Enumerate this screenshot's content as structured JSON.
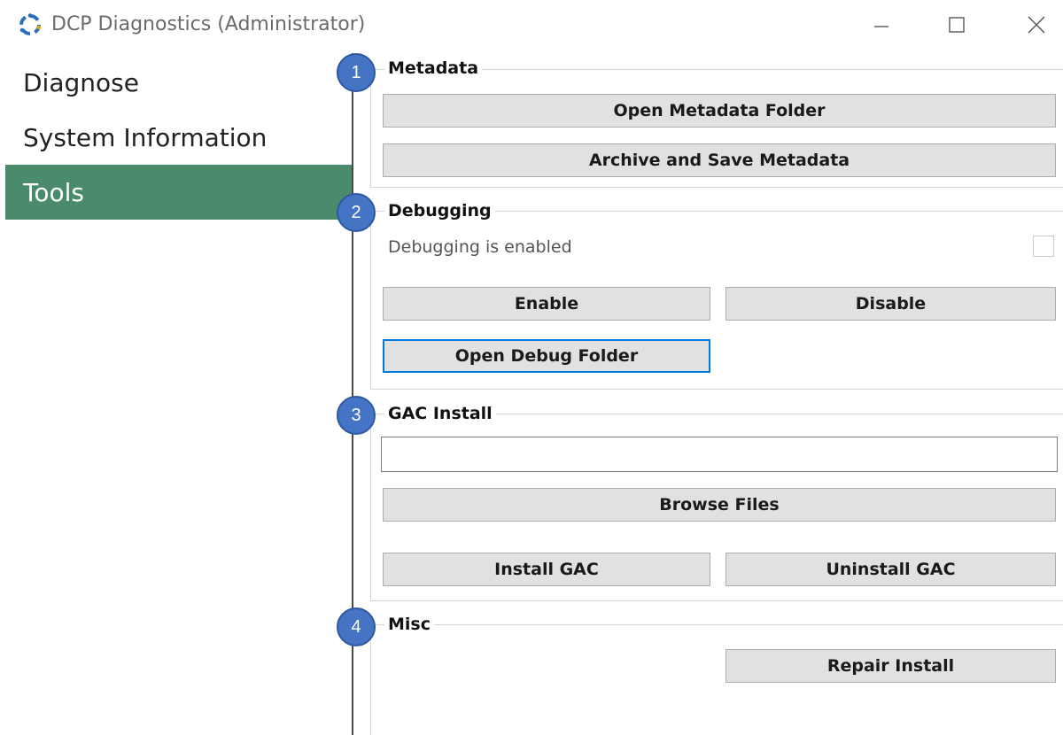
{
  "window": {
    "title": "DCP Diagnostics (Administrator)",
    "controls": {
      "minimize": "minimize-icon",
      "maximize": "maximize-icon",
      "close": "close-icon"
    }
  },
  "sidebar": {
    "items": [
      {
        "label": "Diagnose",
        "selected": false
      },
      {
        "label": "System Information",
        "selected": false
      },
      {
        "label": "Tools",
        "selected": true
      }
    ],
    "selected_color": "#4a8b6c"
  },
  "badges": [
    "1",
    "2",
    "3",
    "4"
  ],
  "metadata": {
    "title": "Metadata",
    "open_folder_label": "Open Metadata Folder",
    "archive_label": "Archive and Save Metadata"
  },
  "debugging": {
    "title": "Debugging",
    "status_label": "Debugging is enabled",
    "checked": false,
    "enable_label": "Enable",
    "disable_label": "Disable",
    "open_folder_label": "Open Debug Folder"
  },
  "gac": {
    "title": "GAC Install",
    "path_value": "",
    "browse_label": "Browse Files",
    "install_label": "Install GAC",
    "uninstall_label": "Uninstall GAC"
  },
  "misc": {
    "title": "Misc",
    "repair_label": "Repair Install"
  },
  "colors": {
    "badge": "#4674c4",
    "focus": "#0078d7",
    "button": "#e1e1e1"
  }
}
